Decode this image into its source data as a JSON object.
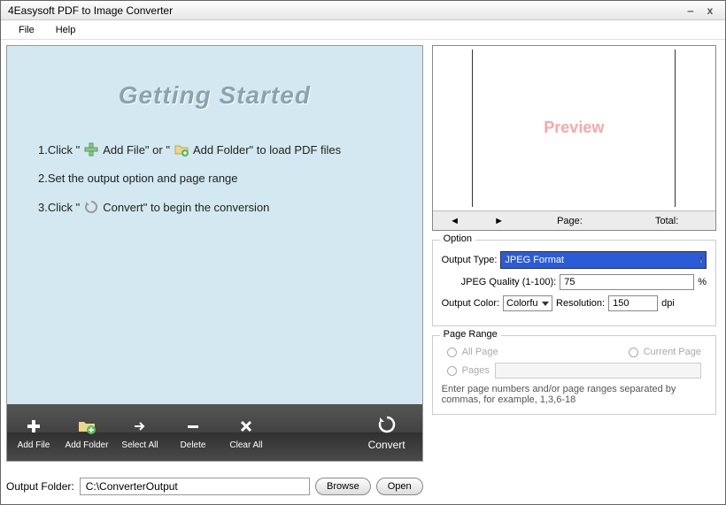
{
  "window": {
    "title": "4Easysoft PDF to Image Converter"
  },
  "menu": {
    "file": "File",
    "help": "Help"
  },
  "getting_started": {
    "heading": "Getting Started",
    "step1a": "1.Click \"",
    "step1b": "Add File\" or \"",
    "step1c": "Add Folder\" to load PDF files",
    "step2": "2.Set the output option and page range",
    "step3a": "3.Click \"",
    "step3b": "Convert\" to begin the conversion"
  },
  "toolbar": {
    "add_file": "Add File",
    "add_folder": "Add Folder",
    "select_all": "Select All",
    "delete": "Delete",
    "clear_all": "Clear All",
    "convert": "Convert"
  },
  "output": {
    "label": "Output Folder:",
    "path": "C:\\ConverterOutput",
    "browse": "Browse",
    "open": "Open"
  },
  "preview": {
    "label": "Preview",
    "page_label": "Page:",
    "total_label": "Total:"
  },
  "option": {
    "group_title": "Option",
    "output_type_label": "Output Type:",
    "output_type_value": "JPEG Format",
    "quality_label": "JPEG Quality (1-100):",
    "quality_value": "75",
    "quality_suffix": "%",
    "color_label": "Output Color:",
    "color_value": "Colorfu",
    "resolution_label": "Resolution:",
    "resolution_value": "150",
    "resolution_suffix": "dpi"
  },
  "pagerange": {
    "group_title": "Page Range",
    "all": "All Page",
    "current": "Current Page",
    "pages": "Pages",
    "hint": "Enter page numbers and/or page ranges separated by commas, for example, 1,3,6-18"
  }
}
